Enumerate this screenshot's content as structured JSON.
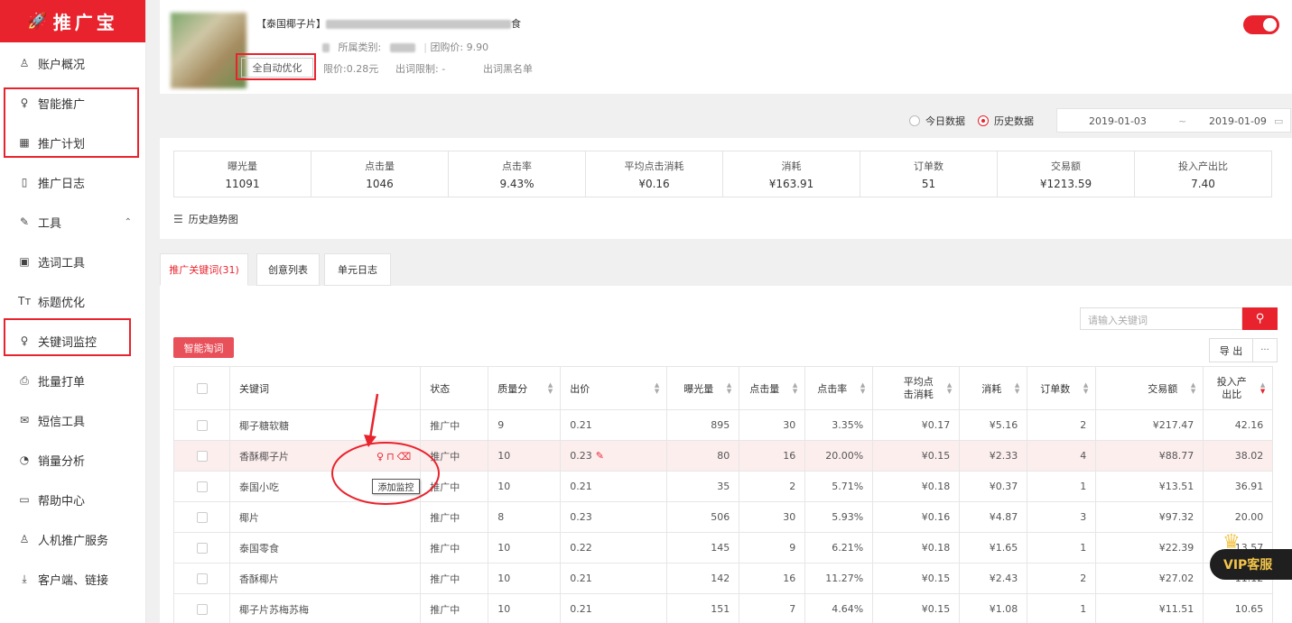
{
  "app": {
    "logo_text": "推广宝"
  },
  "sidebar": {
    "items": [
      {
        "label": "账户概况",
        "icon": "user-icon"
      },
      {
        "label": "智能推广",
        "icon": "bulb-icon"
      },
      {
        "label": "推广计划",
        "icon": "grid-icon"
      },
      {
        "label": "推广日志",
        "icon": "doc-icon"
      },
      {
        "label": "工具",
        "icon": "wrench-icon"
      },
      {
        "label": "选词工具",
        "icon": "search-doc-icon"
      },
      {
        "label": "标题优化",
        "icon": "text-icon"
      },
      {
        "label": "关键词监控",
        "icon": "bulb-icon"
      },
      {
        "label": "批量打单",
        "icon": "printer-icon"
      },
      {
        "label": "短信工具",
        "icon": "mail-icon"
      },
      {
        "label": "销量分析",
        "icon": "chart-icon"
      },
      {
        "label": "帮助中心",
        "icon": "monitor-icon"
      },
      {
        "label": "人机推广服务",
        "icon": "user-icon"
      },
      {
        "label": "客户端、链接",
        "icon": "download-icon"
      }
    ]
  },
  "product": {
    "title_prefix": "【泰国椰子片】",
    "title_suffix": "食",
    "category_label": "所属类别:",
    "group_price": "团购价: 9.90",
    "auto_opt": "全自动优化",
    "limit_price": "限价:0.28元",
    "word_limit": "出词限制: -",
    "blacklist": "出词黑名单"
  },
  "date_filter": {
    "today": "今日数据",
    "history": "历史数据",
    "start": "2019-01-03",
    "sep": "~",
    "end": "2019-01-09"
  },
  "stats": [
    {
      "label": "曝光量",
      "value": "11091"
    },
    {
      "label": "点击量",
      "value": "1046"
    },
    {
      "label": "点击率",
      "value": "9.43%"
    },
    {
      "label": "平均点击消耗",
      "value": "¥0.16"
    },
    {
      "label": "消耗",
      "value": "¥163.91"
    },
    {
      "label": "订单数",
      "value": "51"
    },
    {
      "label": "交易额",
      "value": "¥1213.59"
    },
    {
      "label": "投入产出比",
      "value": "7.40"
    }
  ],
  "trend_label": "历史趋势图",
  "tabs": [
    "推广关键词(31)",
    "创意列表",
    "单元日志"
  ],
  "search": {
    "placeholder": "请输入关键词"
  },
  "smart_btn": "智能淘词",
  "export_btn": "导 出",
  "more_btn": "···",
  "table": {
    "headers": [
      "关键词",
      "状态",
      "质量分",
      "出价",
      "曝光量",
      "点击量",
      "点击率",
      "平均点击消耗",
      "消耗",
      "订单数",
      "交易额",
      "投入产出比"
    ],
    "rows": [
      [
        "椰子糖软糖",
        "推广中",
        "9",
        "0.21",
        "895",
        "30",
        "3.35%",
        "¥0.17",
        "¥5.16",
        "2",
        "¥217.47",
        "42.16"
      ],
      [
        "香酥椰子片",
        "推广中",
        "10",
        "0.23",
        "80",
        "16",
        "20.00%",
        "¥0.15",
        "¥2.33",
        "4",
        "¥88.77",
        "38.02"
      ],
      [
        "泰国小吃",
        "推广中",
        "10",
        "0.21",
        "35",
        "2",
        "5.71%",
        "¥0.18",
        "¥0.37",
        "1",
        "¥13.51",
        "36.91"
      ],
      [
        "椰片",
        "推广中",
        "8",
        "0.23",
        "506",
        "30",
        "5.93%",
        "¥0.16",
        "¥4.87",
        "3",
        "¥97.32",
        "20.00"
      ],
      [
        "泰国零食",
        "推广中",
        "10",
        "0.22",
        "145",
        "9",
        "6.21%",
        "¥0.18",
        "¥1.65",
        "1",
        "¥22.39",
        "13.57"
      ],
      [
        "香酥椰片",
        "推广中",
        "10",
        "0.21",
        "142",
        "16",
        "11.27%",
        "¥0.15",
        "¥2.43",
        "2",
        "¥27.02",
        "11.12"
      ],
      [
        "椰子片苏梅苏梅",
        "推广中",
        "10",
        "0.21",
        "151",
        "7",
        "4.64%",
        "¥0.15",
        "¥1.08",
        "1",
        "¥11.51",
        "10.65"
      ]
    ]
  },
  "tooltip": "添加监控",
  "vip_label": "VIP客服",
  "colors": {
    "accent": "#e8232d",
    "highlight_row": "#fdeeee",
    "vip_gold": "#f3c54a"
  }
}
